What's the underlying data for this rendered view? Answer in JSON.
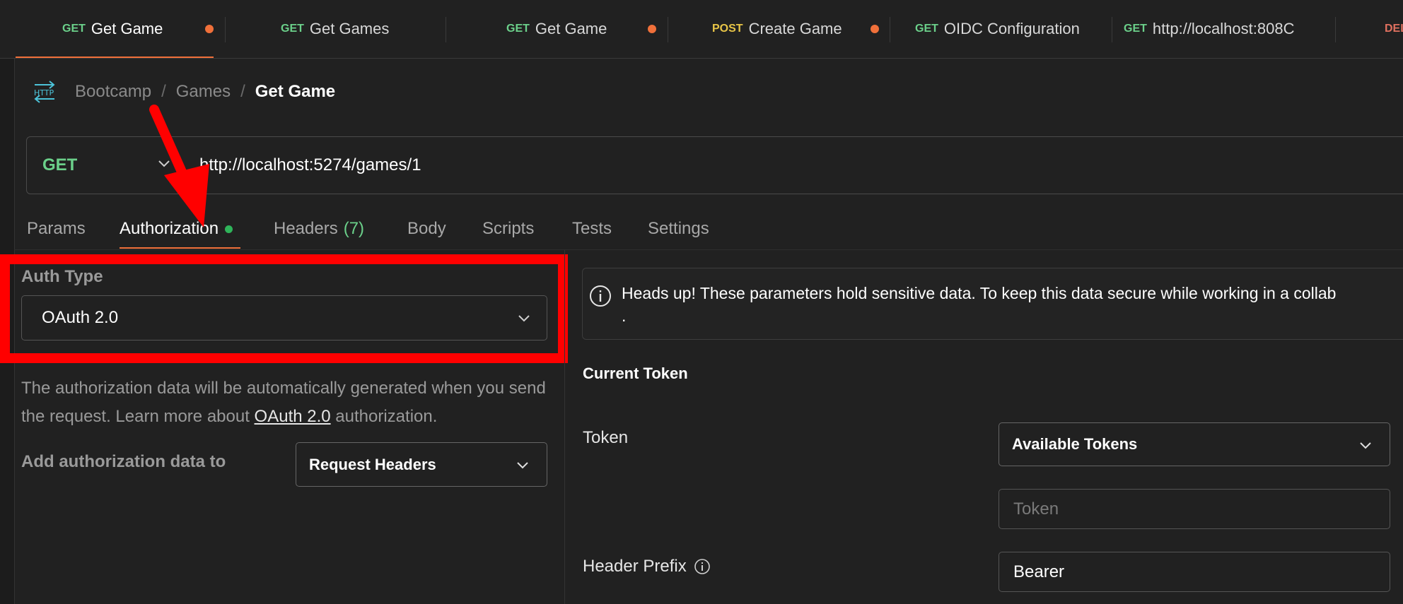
{
  "tabs": [
    {
      "method": "GET",
      "title": "Get Game",
      "method_color": "#6bd08a",
      "dirty": true,
      "active": true
    },
    {
      "method": "GET",
      "title": "Get Games",
      "method_color": "#6bd08a",
      "dirty": false,
      "active": false
    },
    {
      "method": "GET",
      "title": "Get Game",
      "method_color": "#6bd08a",
      "dirty": true,
      "active": false
    },
    {
      "method": "POST",
      "title": "Create Game",
      "method_color": "#e8c547",
      "dirty": true,
      "active": false
    },
    {
      "method": "GET",
      "title": "OIDC Configuration",
      "method_color": "#6bd08a",
      "dirty": false,
      "active": false
    },
    {
      "method": "GET",
      "title": "http://localhost:808C",
      "method_color": "#6bd08a",
      "dirty": true,
      "active": false
    },
    {
      "method": "DEL",
      "title": "",
      "method_color": "#e0705f",
      "dirty": false,
      "active": false
    }
  ],
  "breadcrumb": {
    "icon": "http-icon",
    "items": [
      "Bootcamp",
      "Games"
    ],
    "current": "Get Game"
  },
  "request": {
    "method": "GET",
    "url": "http://localhost:5274/games/1"
  },
  "request_tabs": {
    "params": "Params",
    "authorization": "Authorization",
    "headers": "Headers",
    "headers_count": "(7)",
    "body": "Body",
    "scripts": "Scripts",
    "tests": "Tests",
    "settings": "Settings"
  },
  "auth": {
    "type_label": "Auth Type",
    "type_value": "OAuth 2.0",
    "description_before": "The authorization data will be automatically generated when you send the request. Learn more about ",
    "description_link": "OAuth 2.0",
    "description_after": " authorization.",
    "add_to_label": "Add authorization data to",
    "add_to_value": "Request Headers"
  },
  "notice": {
    "text": "Heads up! These parameters hold sensitive data. To keep this data secure while working in a collab",
    "trailing": "."
  },
  "current_token": {
    "section_title": "Current Token",
    "token_label": "Token",
    "available_tokens": "Available Tokens",
    "token_placeholder": "Token",
    "header_prefix_label": "Header Prefix",
    "header_prefix_value": "Bearer"
  },
  "colors": {
    "accent": "#f0703a",
    "get": "#6bd08a",
    "annotation": "#ff0000"
  }
}
